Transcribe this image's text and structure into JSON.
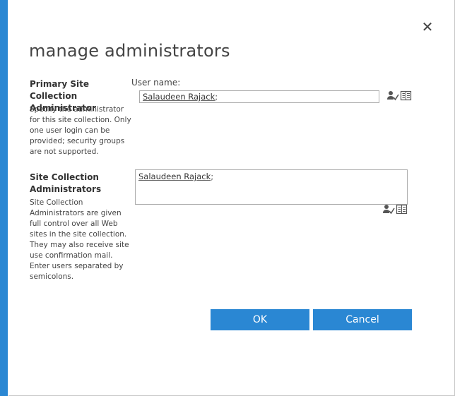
{
  "dialog": {
    "title": "manage administrators",
    "close_icon": "close-icon",
    "accent_color": "#2a87d3"
  },
  "primary_admin": {
    "heading": "Primary Site Collection Administrator",
    "description": "Specify the administrator for this site collection. Only one user login can be provided; security groups are not supported.",
    "field_label": "User name:",
    "value": "Salaudeen Rajack",
    "suffix": ";",
    "check_names_icon": "check-names-icon",
    "browse_icon": "address-book-icon"
  },
  "site_admins": {
    "heading": "Site Collection Administrators",
    "description": "Site Collection Administrators are given full control over all Web sites in the site collection. They may also receive site use confirmation mail. Enter users separated by semicolons.",
    "value": "Salaudeen Rajack",
    "suffix": ";",
    "check_names_icon": "check-names-icon",
    "browse_icon": "address-book-icon"
  },
  "buttons": {
    "ok_label": "OK",
    "cancel_label": "Cancel"
  }
}
